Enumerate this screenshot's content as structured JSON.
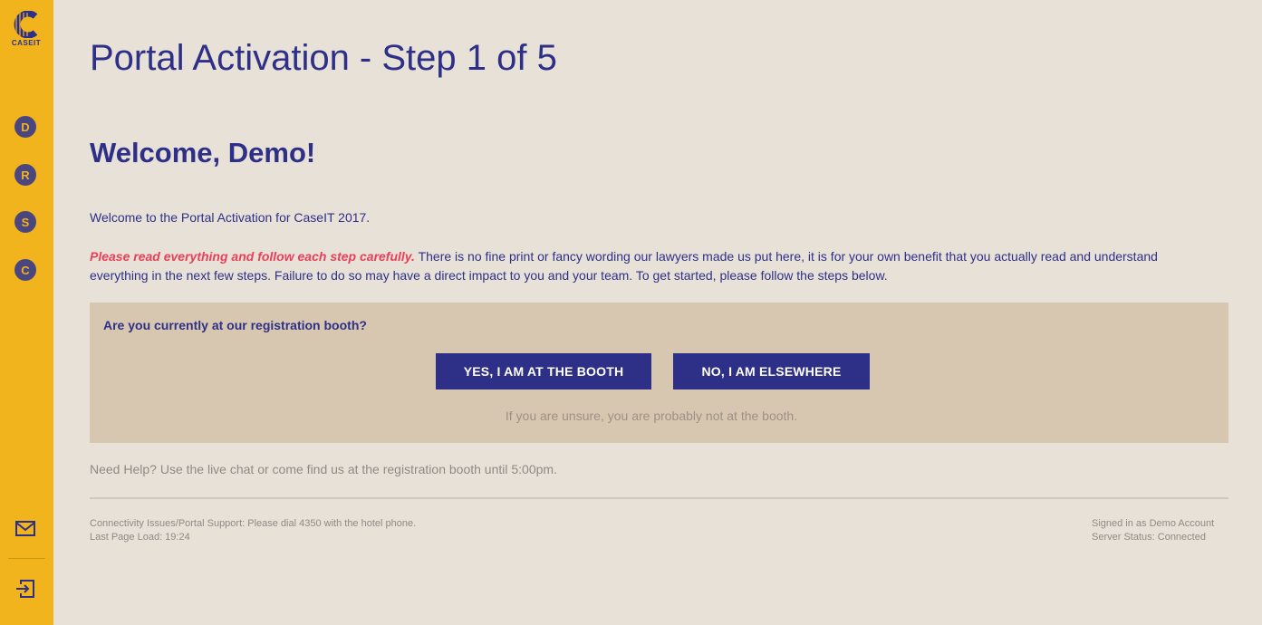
{
  "brand": {
    "logo_text": "CASEIT",
    "accent": "#f2b41c",
    "primary": "#2e3088",
    "background": "#e8e1d7",
    "panel": "#d8c7b0",
    "warning": "#e8405b"
  },
  "sidebar": {
    "items": [
      {
        "letter": "D"
      },
      {
        "letter": "R"
      },
      {
        "letter": "S"
      },
      {
        "letter": "C"
      }
    ],
    "bottom_icons": [
      "mail-icon",
      "sign-out-icon"
    ]
  },
  "page": {
    "title": "Portal Activation - Step 1 of 5",
    "welcome": "Welcome, Demo!",
    "intro": "Welcome to the Portal Activation for CaseIT 2017.",
    "warning": "Please read everything and follow each step carefully.",
    "body": " There is no fine print or fancy wording our lawyers made us put here, it is for your own benefit that you actually read and understand everything in the next few steps. Failure to do so may have a direct impact to you and your team. To get started, please follow the steps below."
  },
  "booth": {
    "question": "Are you currently at our registration booth?",
    "yes_label": "YES, I AM AT THE BOOTH",
    "no_label": "NO, I AM ELSEWHERE",
    "hint": "If you are unsure, you are probably not at the booth."
  },
  "help": "Need Help? Use the live chat or come find us at the registration booth until 5:00pm.",
  "footer": {
    "support": "Connectivity Issues/Portal Support: Please dial 4350 with the hotel phone.",
    "last_load": "Last Page Load: 19:24",
    "signed_in": "Signed in as Demo Account",
    "server_status": "Server Status: Connected"
  }
}
